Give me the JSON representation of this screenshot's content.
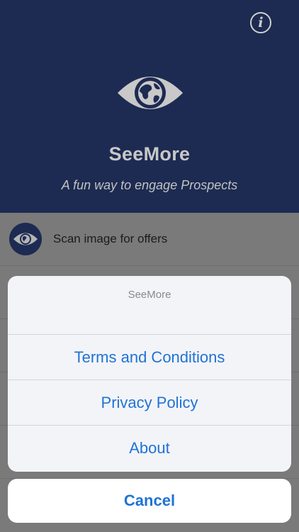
{
  "app": {
    "title": "SeeMore",
    "tagline": "A fun way to engage Prospects",
    "info_icon_glyph": "i",
    "brand_color": "#1d2b52"
  },
  "list": {
    "items": [
      {
        "label": "Scan image for offers",
        "icon": "eye-globe-icon"
      }
    ]
  },
  "action_sheet": {
    "title": "SeeMore",
    "actions": [
      {
        "label": "Terms and Conditions"
      },
      {
        "label": "Privacy Policy"
      },
      {
        "label": "About"
      }
    ],
    "cancel_label": "Cancel",
    "action_color": "#1f73d6"
  }
}
